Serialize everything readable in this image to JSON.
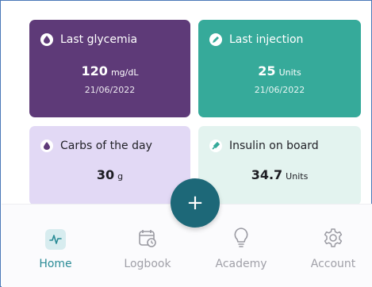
{
  "cards": {
    "last_glycemia": {
      "title": "Last glycemia",
      "value": "120",
      "unit": "mg/dL",
      "date": "21/06/2022",
      "icon": "drop-icon",
      "color": "#5e3a78"
    },
    "last_injection": {
      "title": "Last injection",
      "value": "25",
      "unit": "Units",
      "date": "21/06/2022",
      "icon": "pen-icon",
      "color": "#36aa9a"
    },
    "carbs_of_the_day": {
      "title": "Carbs of the day",
      "value": "30",
      "unit": "g",
      "icon": "drop-icon",
      "color": "#e2d9f5"
    },
    "insulin_on_board": {
      "title": "Insulin on board",
      "value": "34.7",
      "unit": "Units",
      "icon": "syringe-icon",
      "color": "#e3f3ef"
    }
  },
  "fab": {
    "label": "+",
    "icon": "plus-icon"
  },
  "nav": {
    "items": [
      {
        "label": "Home",
        "icon": "activity-icon",
        "active": true
      },
      {
        "label": "Logbook",
        "icon": "calendar-clock-icon",
        "active": false
      },
      {
        "label": "Academy",
        "icon": "lightbulb-icon",
        "active": false
      },
      {
        "label": "Account",
        "icon": "gear-icon",
        "active": false
      }
    ]
  },
  "colors": {
    "accent": "#2a8b96",
    "fab": "#1d6878",
    "inactive": "#a0a0a8"
  }
}
